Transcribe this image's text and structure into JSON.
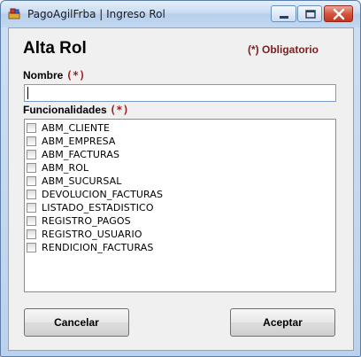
{
  "window": {
    "title": "PagoAgilFrba | Ingreso Rol"
  },
  "form": {
    "title": "Alta Rol",
    "required_note": "(*) Obligatorio",
    "name_label": "Nombre",
    "name_required_mark": "(*)",
    "name_value": "",
    "functions_label": "Funcionalidades",
    "functions_required_mark": "(*)",
    "functions": [
      {
        "label": "ABM_CLIENTE",
        "checked": false
      },
      {
        "label": "ABM_EMPRESA",
        "checked": false
      },
      {
        "label": "ABM_FACTURAS",
        "checked": false
      },
      {
        "label": "ABM_ROL",
        "checked": false
      },
      {
        "label": "ABM_SUCURSAL",
        "checked": false
      },
      {
        "label": "DEVOLUCION_FACTURAS",
        "checked": false
      },
      {
        "label": "LISTADO_ESTADISTICO",
        "checked": false
      },
      {
        "label": "REGISTRO_PAGOS",
        "checked": false
      },
      {
        "label": "REGISTRO_USUARIO",
        "checked": false
      },
      {
        "label": "RENDICION_FACTURAS",
        "checked": false
      }
    ]
  },
  "buttons": {
    "cancel": "Cancelar",
    "accept": "Aceptar"
  },
  "colors": {
    "required_red": "#7b1e1e",
    "title_bar": "#c9dbf1"
  }
}
